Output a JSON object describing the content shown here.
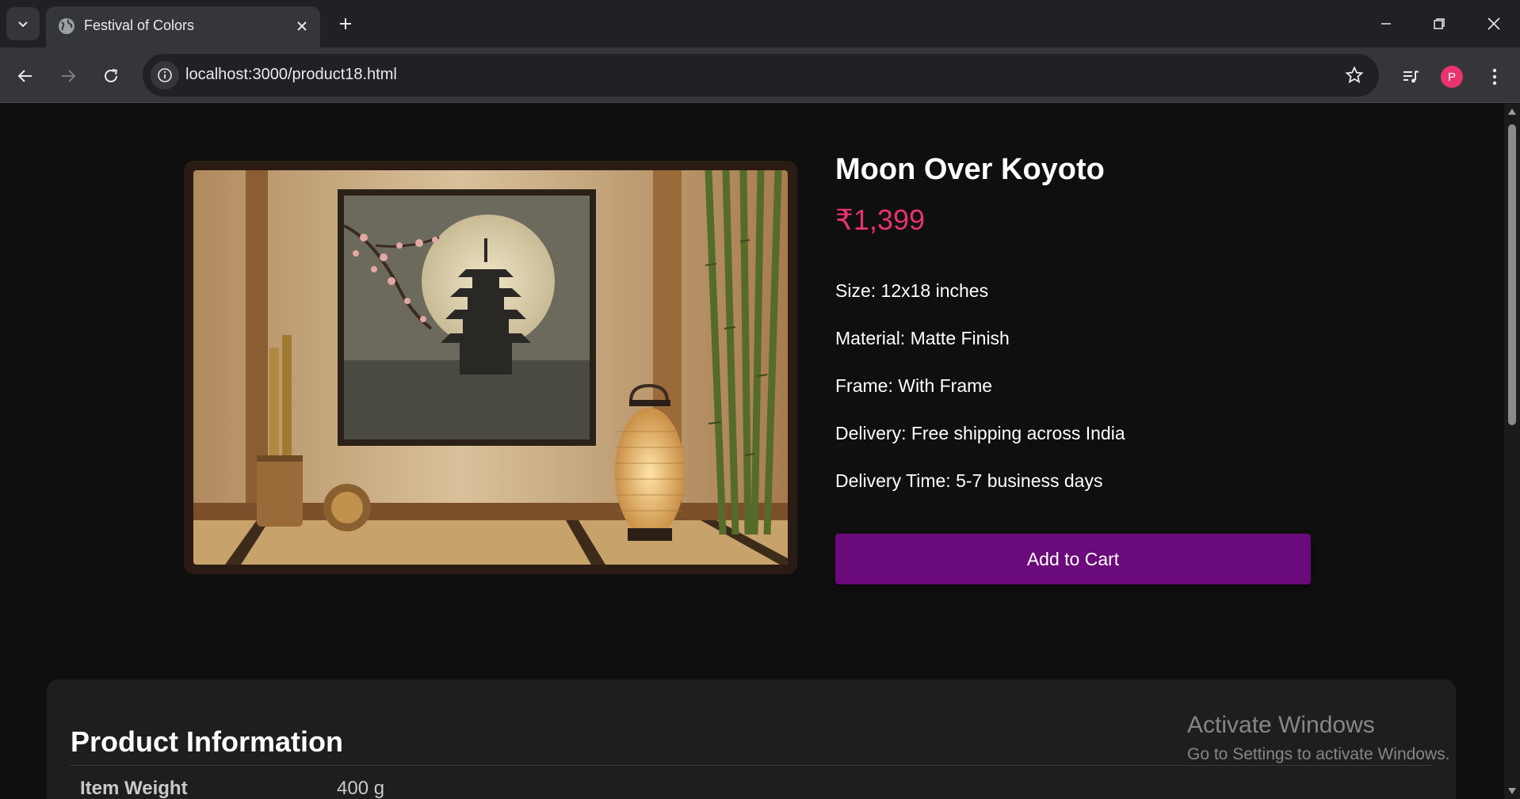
{
  "browser": {
    "tab": {
      "title": "Festival of Colors"
    },
    "address": {
      "url": "localhost:3000/product18.html"
    },
    "profile": {
      "initial": "P"
    }
  },
  "product": {
    "title": "Moon Over Koyoto",
    "price": "₹1,399",
    "specs": [
      "Size: 12x18 inches",
      "Material: Matte Finish",
      "Frame: With Frame",
      "Delivery: Free shipping across India",
      "Delivery Time: 5-7 business days"
    ],
    "add_to_cart_label": "Add to Cart"
  },
  "info": {
    "heading": "Product Information",
    "rows": [
      {
        "key": "Item Weight",
        "value": "400 g"
      }
    ]
  },
  "watermark": {
    "title": "Activate Windows",
    "subtitle": "Go to Settings to activate Windows."
  },
  "colors": {
    "accent_price": "#e8336c",
    "button": "#6b0a7a",
    "background": "#0f0f0f"
  }
}
